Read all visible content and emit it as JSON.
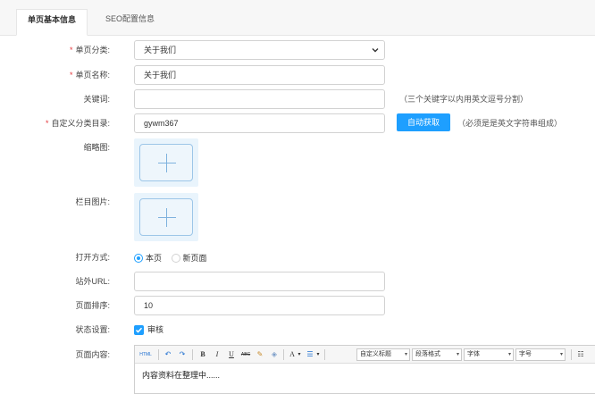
{
  "tabs": [
    {
      "label": "单页基本信息",
      "active": true
    },
    {
      "label": "SEO配置信息",
      "active": false
    }
  ],
  "fields": {
    "category": {
      "label": "单页分类:",
      "required": true,
      "value": "关于我们"
    },
    "name": {
      "label": "单页名称:",
      "required": true,
      "value": "关于我们"
    },
    "keywords": {
      "label": "关键词:",
      "value": "",
      "hint": "（三个关键字以内用英文逗号分割）"
    },
    "custom_dir": {
      "label": "自定义分类目录:",
      "required": true,
      "value": "gywm367",
      "button": "自动获取",
      "hint": "（必须是是英文字符串组成）"
    },
    "thumbnail": {
      "label": "缩略图:"
    },
    "column_image": {
      "label": "栏目图片:"
    },
    "open_mode": {
      "label": "打开方式:",
      "options": [
        "本页",
        "新页面"
      ],
      "selected": "本页"
    },
    "external_url": {
      "label": "站外URL:",
      "value": ""
    },
    "sort": {
      "label": "页面排序:",
      "value": "10"
    },
    "status": {
      "label": "状态设置:",
      "checkbox_label": "审核",
      "checked": true
    },
    "content": {
      "label": "页面内容:",
      "text": "内容资料在整理中......"
    }
  },
  "toolbar": {
    "html": "HTML",
    "bold": "B",
    "italic": "I",
    "underline": "U",
    "strike": "ABC",
    "font_color": "A",
    "selects": [
      "自定义标题",
      "段落格式",
      "字体",
      "字号"
    ]
  },
  "colors": {
    "accent": "#1e9fff",
    "required": "#e4393c"
  }
}
